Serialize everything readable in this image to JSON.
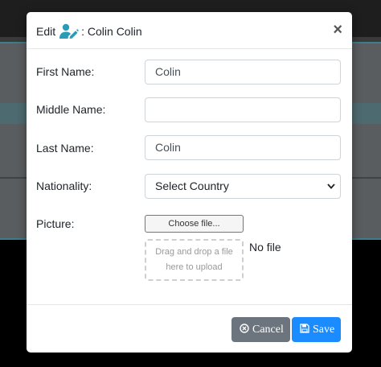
{
  "modal": {
    "title_prefix": "Edit",
    "title_name": ": Colin Colin",
    "close_label": "×"
  },
  "form": {
    "first_name": {
      "label": "First Name:",
      "value": "Colin"
    },
    "middle_name": {
      "label": "Middle Name:",
      "value": ""
    },
    "last_name": {
      "label": "Last Name:",
      "value": "Colin"
    },
    "nationality": {
      "label": "Nationality:",
      "selected": "Select Country"
    },
    "picture": {
      "label": "Picture:",
      "choose_label": "Choose file...",
      "dropzone_line1": "Drag and drop a file",
      "dropzone_line2": "here to upload",
      "status": "No file"
    }
  },
  "footer": {
    "cancel_label": "Cancel",
    "save_label": "Save"
  },
  "colors": {
    "cancel": "#6c757d",
    "save": "#1a8cff",
    "icon_accent": "#2a9bb7"
  },
  "icons": {
    "title": "user-edit-icon",
    "close": "close-icon",
    "cancel": "circle-x-icon",
    "save": "floppy-disk-icon",
    "select": "chevron-down-icon"
  }
}
